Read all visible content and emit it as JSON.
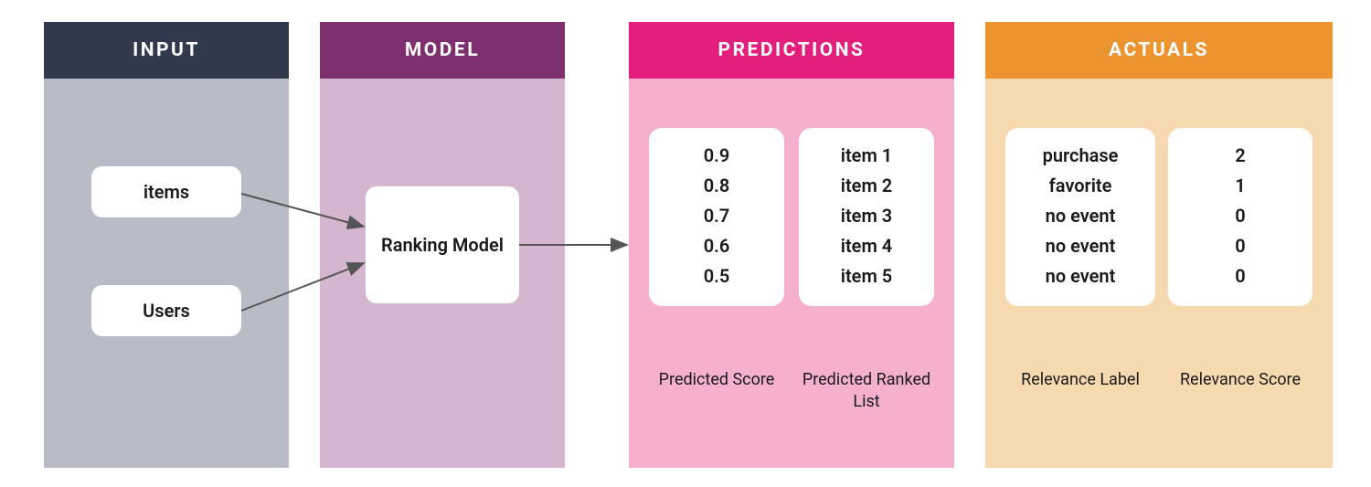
{
  "panels": {
    "input": {
      "title": "INPUT",
      "items_label": "items",
      "users_label": "Users"
    },
    "model": {
      "title": "MODEL",
      "block_label": "Ranking Model"
    },
    "predictions": {
      "title": "PREDICTIONS",
      "score_caption": "Predicted Score",
      "list_caption": "Predicted Ranked List",
      "scores": [
        "0.9",
        "0.8",
        "0.7",
        "0.6",
        "0.5"
      ],
      "ranked_items": [
        "item 1",
        "item 2",
        "item 3",
        "item 4",
        "item 5"
      ]
    },
    "actuals": {
      "title": "ACTUALS",
      "label_caption": "Relevance Label",
      "score_caption": "Relevance Score",
      "labels": [
        "purchase",
        "favorite",
        "no event",
        "no event",
        "no event"
      ],
      "scores": [
        "2",
        "1",
        "0",
        "0",
        "0"
      ]
    }
  },
  "chart_data": {
    "type": "table",
    "title": "Ranking model inputs, predictions, and actuals",
    "columns": [
      "predicted_score",
      "predicted_item",
      "relevance_label",
      "relevance_score"
    ],
    "rows": [
      {
        "predicted_score": 0.9,
        "predicted_item": "item 1",
        "relevance_label": "purchase",
        "relevance_score": 2
      },
      {
        "predicted_score": 0.8,
        "predicted_item": "item 2",
        "relevance_label": "favorite",
        "relevance_score": 1
      },
      {
        "predicted_score": 0.7,
        "predicted_item": "item 3",
        "relevance_label": "no event",
        "relevance_score": 0
      },
      {
        "predicted_score": 0.6,
        "predicted_item": "item 4",
        "relevance_label": "no event",
        "relevance_score": 0
      },
      {
        "predicted_score": 0.5,
        "predicted_item": "item 5",
        "relevance_label": "no event",
        "relevance_score": 0
      }
    ],
    "flow": [
      "INPUT (items, Users)",
      "MODEL (Ranking Model)",
      "PREDICTIONS",
      "ACTUALS"
    ]
  }
}
